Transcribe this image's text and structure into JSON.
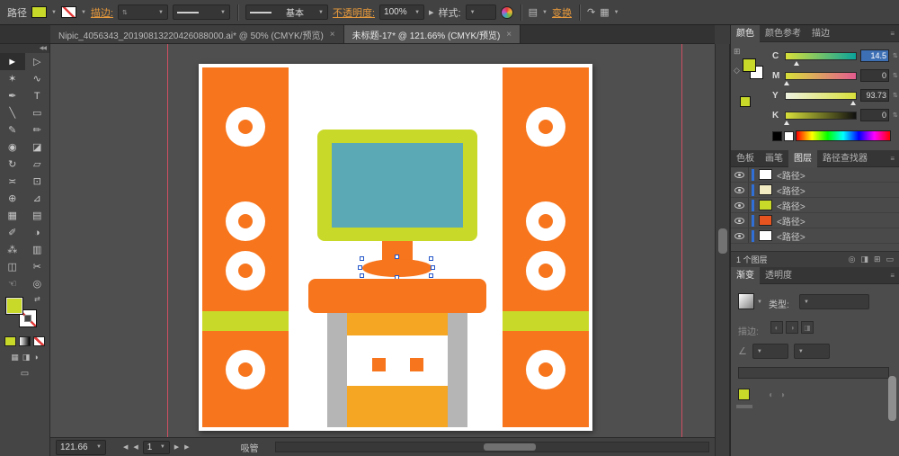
{
  "colors": {
    "accent": "#c9d929",
    "orange": "#f7751d",
    "teal": "#5aa9b4",
    "amber": "#f5a623",
    "leg": "#b5b5b5",
    "link": "#e89a3c",
    "blue": "#2f6fd6",
    "guide": "#cf4f62"
  },
  "icons": {
    "dropdown": "▼",
    "menu": "≡",
    "close": "×",
    "spin": "⇅",
    "prev": "◀",
    "next": "▶",
    "more": "▸",
    "collapse": "◀◀",
    "swap": "⇄",
    "align": "▤",
    "arrange": "↷",
    "workspace": "▦",
    "grid": "⊞",
    "cube": "◇",
    "angle": "∠",
    "locate": "◎",
    "mask": "◨",
    "newlayer": "⊞",
    "trash": "▭",
    "half1": "◐",
    "half2": "◑"
  },
  "control_bar": {
    "object_type": "路径",
    "stroke_link": "描边:",
    "brush_name": "基本",
    "opacity_link": "不透明度:",
    "opacity_value": "100%",
    "style_label": "样式:",
    "transform_link": "变换"
  },
  "document_tabs": [
    {
      "title": "Nipic_4056343_20190813220426088000.ai* @ 50% (CMYK/预览)"
    },
    {
      "title": "未标题-17* @ 121.66% (CMYK/预览)"
    }
  ],
  "toolbar": {
    "tools": [
      {
        "name": "selection",
        "glyph": "►"
      },
      {
        "name": "direct-selection",
        "glyph": "▷"
      },
      {
        "name": "magic-wand",
        "glyph": "✶"
      },
      {
        "name": "lasso",
        "glyph": "∿"
      },
      {
        "name": "pen",
        "glyph": "✒"
      },
      {
        "name": "type",
        "glyph": "T"
      },
      {
        "name": "line-segment",
        "glyph": "╲"
      },
      {
        "name": "rectangle",
        "glyph": "▭"
      },
      {
        "name": "paintbrush",
        "glyph": "✎"
      },
      {
        "name": "pencil",
        "glyph": "✏"
      },
      {
        "name": "blob-brush",
        "glyph": "◉"
      },
      {
        "name": "eraser",
        "glyph": "◪"
      },
      {
        "name": "rotate",
        "glyph": "↻"
      },
      {
        "name": "scale",
        "glyph": "▱"
      },
      {
        "name": "width",
        "glyph": "≍"
      },
      {
        "name": "free-transform",
        "glyph": "⊡"
      },
      {
        "name": "shape-builder",
        "glyph": "⊕"
      },
      {
        "name": "perspective-grid",
        "glyph": "⊿"
      },
      {
        "name": "mesh",
        "glyph": "▦"
      },
      {
        "name": "gradient",
        "glyph": "▤"
      },
      {
        "name": "eyedropper",
        "glyph": "✐"
      },
      {
        "name": "blend",
        "glyph": "◑"
      },
      {
        "name": "symbol-sprayer",
        "glyph": "⁂"
      },
      {
        "name": "column-graph",
        "glyph": "▥"
      },
      {
        "name": "artboard",
        "glyph": "◫"
      },
      {
        "name": "slice",
        "glyph": "✂"
      },
      {
        "name": "hand",
        "glyph": "☜"
      },
      {
        "name": "zoom",
        "glyph": "◎"
      }
    ]
  },
  "color_panel": {
    "tabs": [
      "颜色",
      "颜色参考",
      "描边"
    ],
    "sliders": [
      {
        "channel": "C",
        "value": "14.5"
      },
      {
        "channel": "M",
        "value": "0"
      },
      {
        "channel": "Y",
        "value": "93.73"
      },
      {
        "channel": "K",
        "value": "0"
      }
    ]
  },
  "middle_panel": {
    "tabs": [
      "色板",
      "画笔",
      "图层",
      "路径查找器"
    ],
    "layers": [
      {
        "name": "<路径>",
        "thumb_style": "background:#ffffff"
      },
      {
        "name": "<路径>",
        "thumb_style": "background:#f3ecc2"
      },
      {
        "name": "<路径>",
        "thumb_style": "background:#c9d929"
      },
      {
        "name": "<路径>",
        "thumb_style": "background:#e8541f"
      },
      {
        "name": "<路径>",
        "thumb_style": "background:#ffffff"
      }
    ],
    "footer": "1 个图层"
  },
  "bottom_panel": {
    "tabs": [
      "渐变",
      "透明度"
    ],
    "type_label": "类型:",
    "stroke_label": "描边:"
  },
  "status_bar": {
    "zoom": "121.66",
    "artboard": "1",
    "tool": "吸管"
  }
}
